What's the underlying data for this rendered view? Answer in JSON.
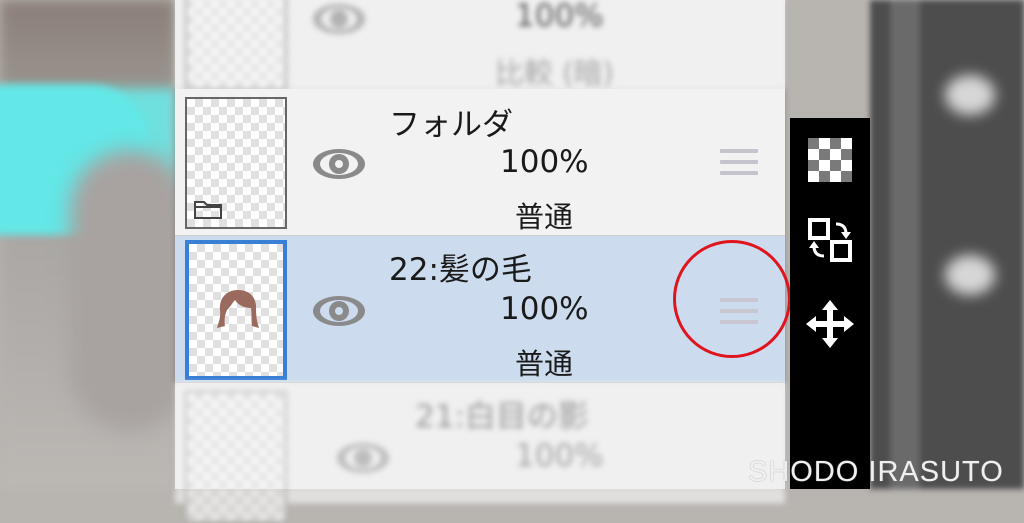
{
  "layers": [
    {
      "name": "比較 (暗)",
      "opacity": "100%",
      "blend": "",
      "visible_icon": "eye-icon",
      "state": "blurred-partial"
    },
    {
      "name": "フォルダ",
      "opacity": "100%",
      "blend": "普通",
      "type": "folder",
      "visible_icon": "eye-icon"
    },
    {
      "name": "22:髪の毛",
      "opacity": "100%",
      "blend": "普通",
      "selected": true,
      "visible_icon": "eye-icon"
    },
    {
      "name": "21:白目の影",
      "opacity": "100%",
      "blend": "",
      "state": "blurred-partial"
    }
  ],
  "tools": [
    {
      "name": "transparency-tool-icon"
    },
    {
      "name": "swap-layer-icon"
    },
    {
      "name": "move-tool-icon"
    }
  ],
  "colors": {
    "selection_highlight": "#ccdcee",
    "selection_border": "#3a7fd6",
    "annotation_circle": "#e0141c",
    "hair_color": "#9a6a5e"
  },
  "watermark": "SHODO IRASUTO"
}
